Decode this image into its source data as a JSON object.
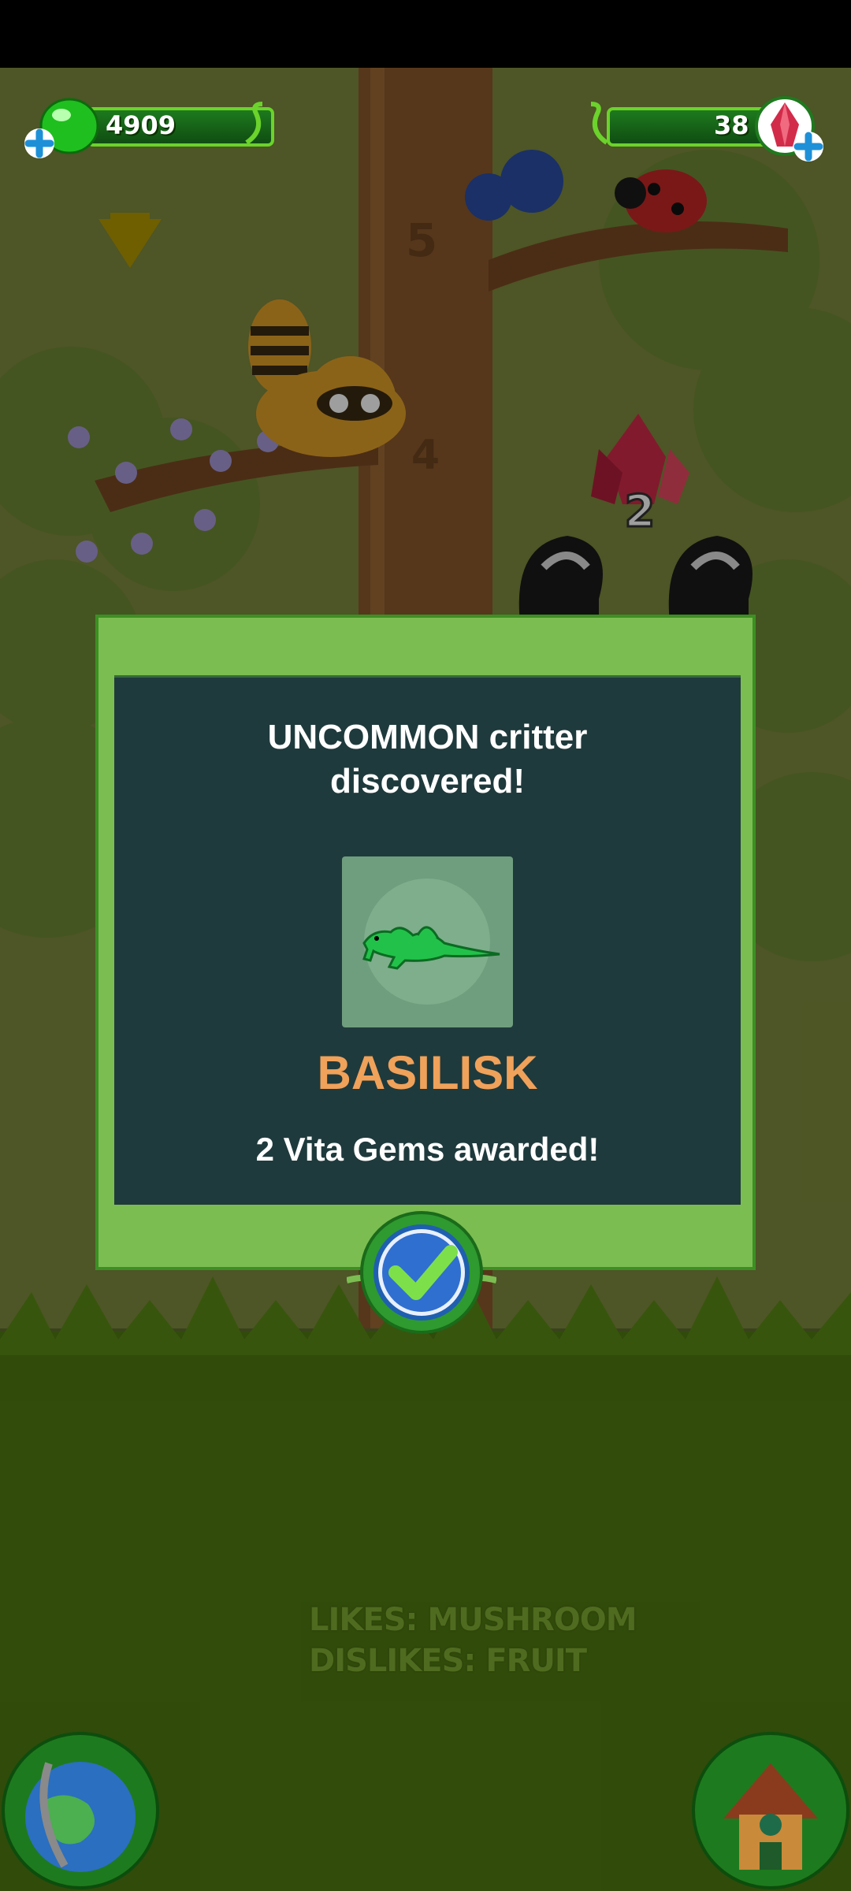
{
  "hud": {
    "left_counter": "4909",
    "right_counter": "38",
    "left_icon": "green-gem-icon",
    "right_icon": "red-crystal-icon"
  },
  "scene": {
    "tree_number_upper": "5",
    "tree_number_lower": "4",
    "floating_reward": "2"
  },
  "dialog": {
    "title_line1": "UNCOMMON critter",
    "title_line2": "discovered!",
    "critter_name": "BASILISK",
    "reward_text": "2 Vita Gems awarded!",
    "confirm_icon": "checkmark-icon"
  },
  "footer": {
    "likes": "LIKES: MUSHROOM",
    "dislikes": "DISLIKES: FRUIT"
  },
  "colors": {
    "dialog_frame": "#7cbd52",
    "dialog_panel": "#1f3a3c",
    "critter_name": "#f0a15a"
  }
}
